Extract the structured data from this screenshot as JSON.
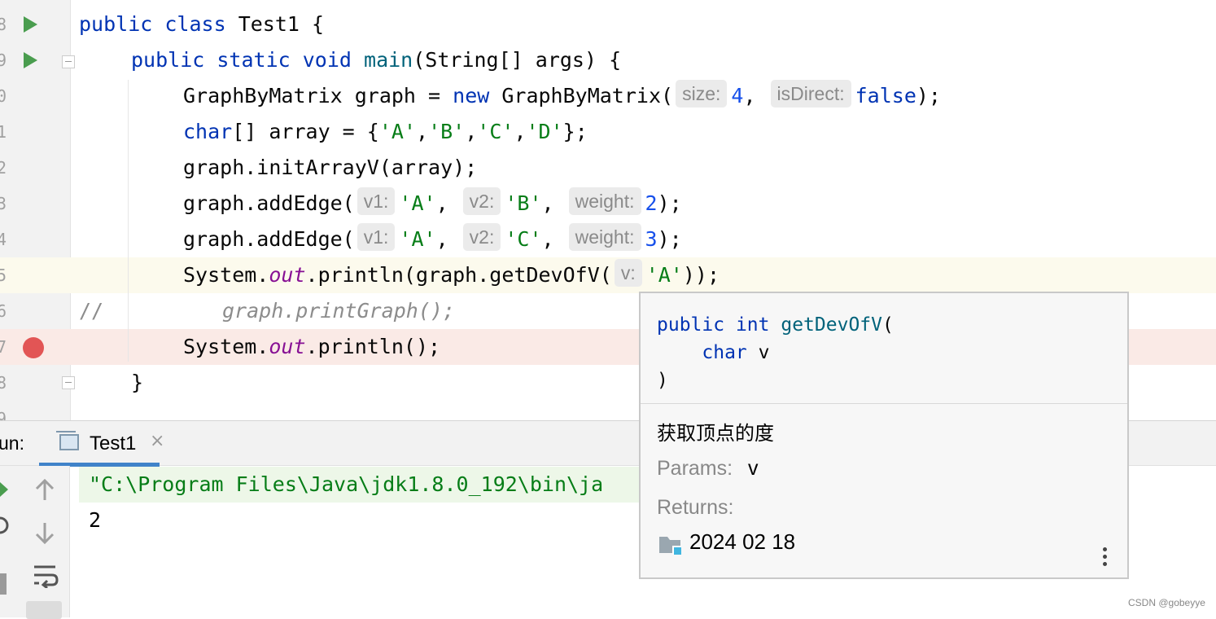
{
  "editor": {
    "line_numbers": [
      "8",
      "9",
      "0",
      "1",
      "2",
      "3",
      "4",
      "5",
      "6",
      "7",
      "8",
      "9"
    ],
    "code": {
      "l1": {
        "kw1": "public",
        "kw2": "class",
        "rest": "Test1 {"
      },
      "l2": {
        "kw1": "public",
        "kw2": "static",
        "kw3": "void",
        "fn": "main",
        "rest": "(String[] args) {"
      },
      "l3": {
        "a": "GraphByMatrix graph = ",
        "kw": "new",
        "b": " GraphByMatrix(",
        "h1": "size:",
        "v1": "4",
        ",": ", ",
        "h2": "isDirect:",
        "v2": "false",
        "c": ");"
      },
      "l4": {
        "kw": "char",
        "a": "[] array = {",
        "s1": "'A'",
        "s2": "'B'",
        "s3": "'C'",
        "s4": "'D'",
        "comma": ",",
        "c": "};"
      },
      "l5": {
        "a": "graph.initArrayV(array);"
      },
      "l6": {
        "a": "graph.addEdge(",
        "h1": "v1:",
        "s1": "'A'",
        "comma": ", ",
        "h2": "v2:",
        "s2": "'B'",
        "h3": "weight:",
        "n": "2",
        "c": ");"
      },
      "l7": {
        "a": "graph.addEdge(",
        "h1": "v1:",
        "s1": "'A'",
        "comma": ", ",
        "h2": "v2:",
        "s2": "'C'",
        "h3": "weight:",
        "n": "3",
        "c": ");"
      },
      "l8": {
        "a": "System.",
        "f": "out",
        "b": ".println(graph.getDevOfV(",
        "h1": "v:",
        "s1": "'A'",
        "c": "));"
      },
      "l9": {
        "cmt": "//",
        "rest": "graph.printGraph();"
      },
      "l10": {
        "a": "System.",
        "f": "out",
        "b": ".println();"
      },
      "l11": {
        "a": "}"
      }
    }
  },
  "run_panel": {
    "label": "un:",
    "tab_label": "Test1",
    "tab_close": "×",
    "console_cmd": "\"C:\\Program Files\\Java\\jdk1.8.0_192\\bin\\ja",
    "console_output": "2",
    "icons": [
      "up-arrow-icon",
      "down-arrow-icon",
      "soft-wrap-icon",
      "scroll-to-end-icon"
    ]
  },
  "popup": {
    "sig_kw1": "public",
    "sig_kw2": "int",
    "sig_fn": "getDevOfV",
    "sig_open": "(",
    "sig_param_kw": "char",
    "sig_param": "v",
    "sig_close": ")",
    "description": "获取顶点的度",
    "params_label": "Params:",
    "params_value": "v",
    "returns_label": "Returns:",
    "source": "2024 02 18"
  },
  "watermark": "CSDN @gobeyye",
  "colors": {
    "keyword": "#0033b3",
    "string": "#067d17",
    "number": "#1750eb",
    "field": "#871094",
    "breakpoint": "#e25555",
    "run": "#4a9d4f",
    "tab_underline": "#4083c9"
  }
}
